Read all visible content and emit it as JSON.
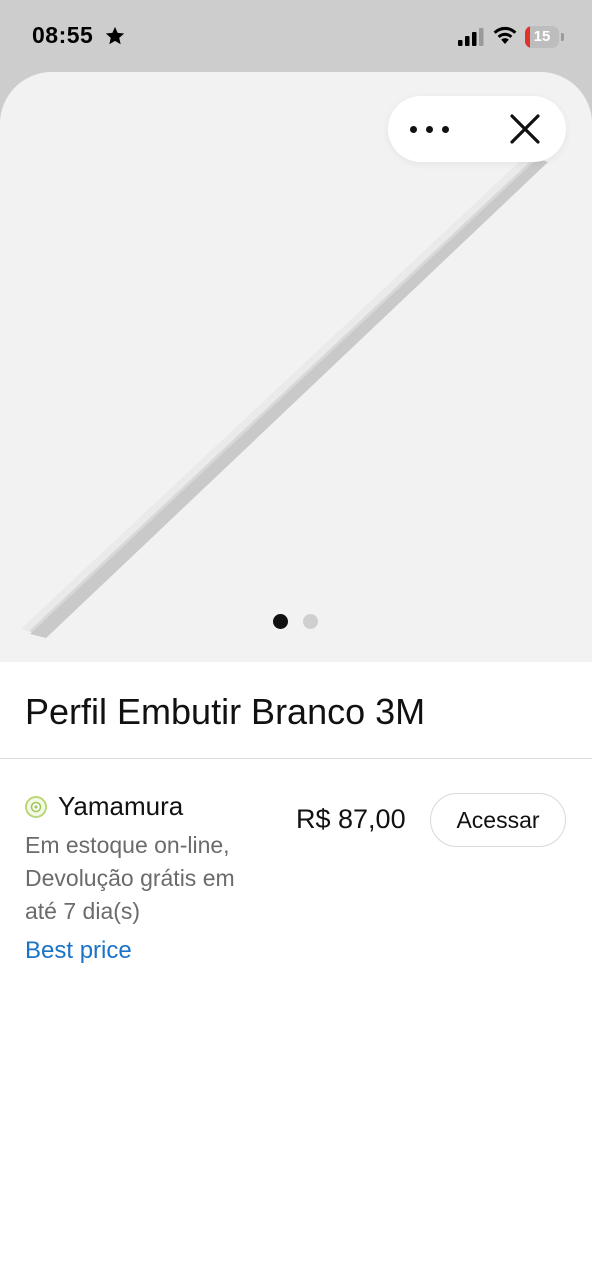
{
  "status_bar": {
    "time": "08:55",
    "battery_level": "15",
    "battery_percent": 15
  },
  "product": {
    "title": "Perfil Embutir Branco 3M",
    "image_count": 2,
    "active_image": 1
  },
  "offer": {
    "store_name": "Yamamura",
    "details_line1": "Em estoque on-line,",
    "details_line2": "Devolução grátis em",
    "details_line3": "até 7 dia(s)",
    "badge": "Best price",
    "price": "R$ 87,00",
    "button_label": "Acessar"
  },
  "icons": {
    "more": "ellipsis-icon",
    "close": "close-icon",
    "star": "star-icon",
    "signal": "cellular-signal-icon",
    "wifi": "wifi-icon",
    "battery": "battery-icon",
    "store": "store-logo-icon"
  },
  "colors": {
    "link": "#1a73c8",
    "battery_low": "#e0312b",
    "image_background": "#f2f2f2"
  }
}
